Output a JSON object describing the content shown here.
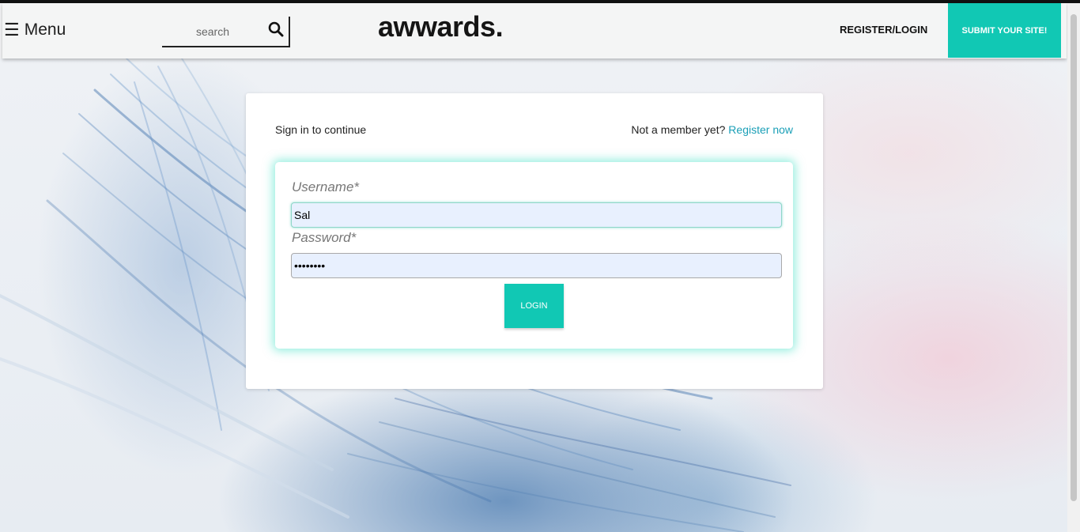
{
  "header": {
    "menu_icon": "hamburger-icon",
    "menu_label": "Menu",
    "search_placeholder": "search",
    "search_icon": "search-icon",
    "logo": "awwards.",
    "register_login": "REGISTER/LOGIN",
    "submit_site": "SUBMIT YOUR SITE!"
  },
  "card": {
    "signin_text": "Sign in to continue",
    "not_member_text": "Not a member yet?",
    "register_now": "Register now",
    "username_label": "Username*",
    "username_value": "Sal",
    "password_label": "Password*",
    "password_value": "********",
    "login_button": "LOGIN"
  },
  "colors": {
    "accent": "#11c8b4",
    "link": "#1a9fb7",
    "autofill_bg": "#e8f0fe"
  }
}
